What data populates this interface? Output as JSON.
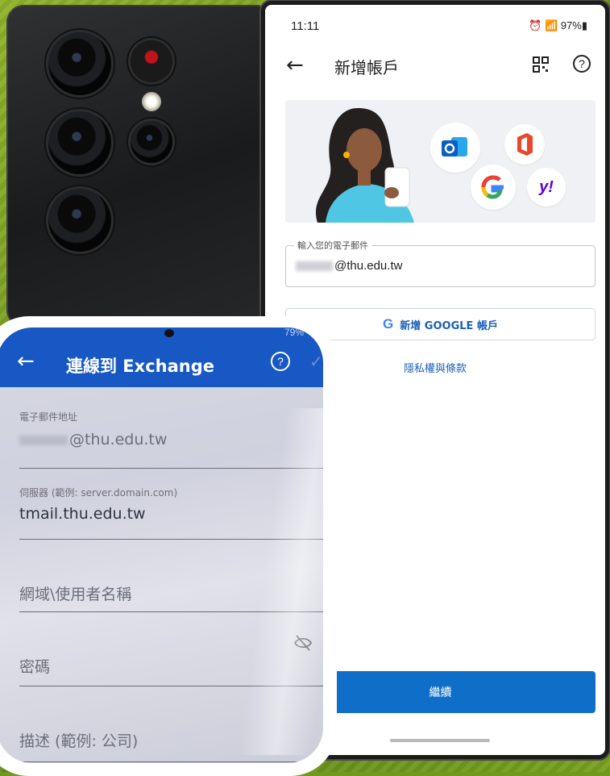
{
  "phone": {
    "status": {
      "time": "11:11",
      "battery": "97%"
    },
    "appbar": {
      "title": "新增帳戶",
      "help": "?"
    },
    "email": {
      "label": "輸入您的電子郵件",
      "value": "@thu.edu.tw"
    },
    "google_button": {
      "letter": "G",
      "label": "新增 GOOGLE 帳戶"
    },
    "privacy_link": "隱私權與條款",
    "continue_label": "繼續",
    "hero_logos": [
      "outlook-icon",
      "office-icon",
      "google-icon",
      "yahoo-icon"
    ],
    "yahoo_text": "y!"
  },
  "exchange": {
    "status": {
      "battery": "79%"
    },
    "title": "連線到 Exchange",
    "help": "?",
    "email": {
      "label": "電子郵件地址",
      "value": "@thu.edu.tw"
    },
    "server": {
      "label": "伺服器 (範例: server.domain.com)",
      "value": "tmail.thu.edu.tw"
    },
    "domain_user_placeholder": "網域\\使用者名稱",
    "password_placeholder": "密碼",
    "description_placeholder": "描述 (範例: 公司)"
  },
  "colors": {
    "exchange_bar": "#1758c4",
    "continue_button": "#0f6fc8",
    "link_blue": "#1c5fb8",
    "background_green": "#6f9a1e"
  }
}
